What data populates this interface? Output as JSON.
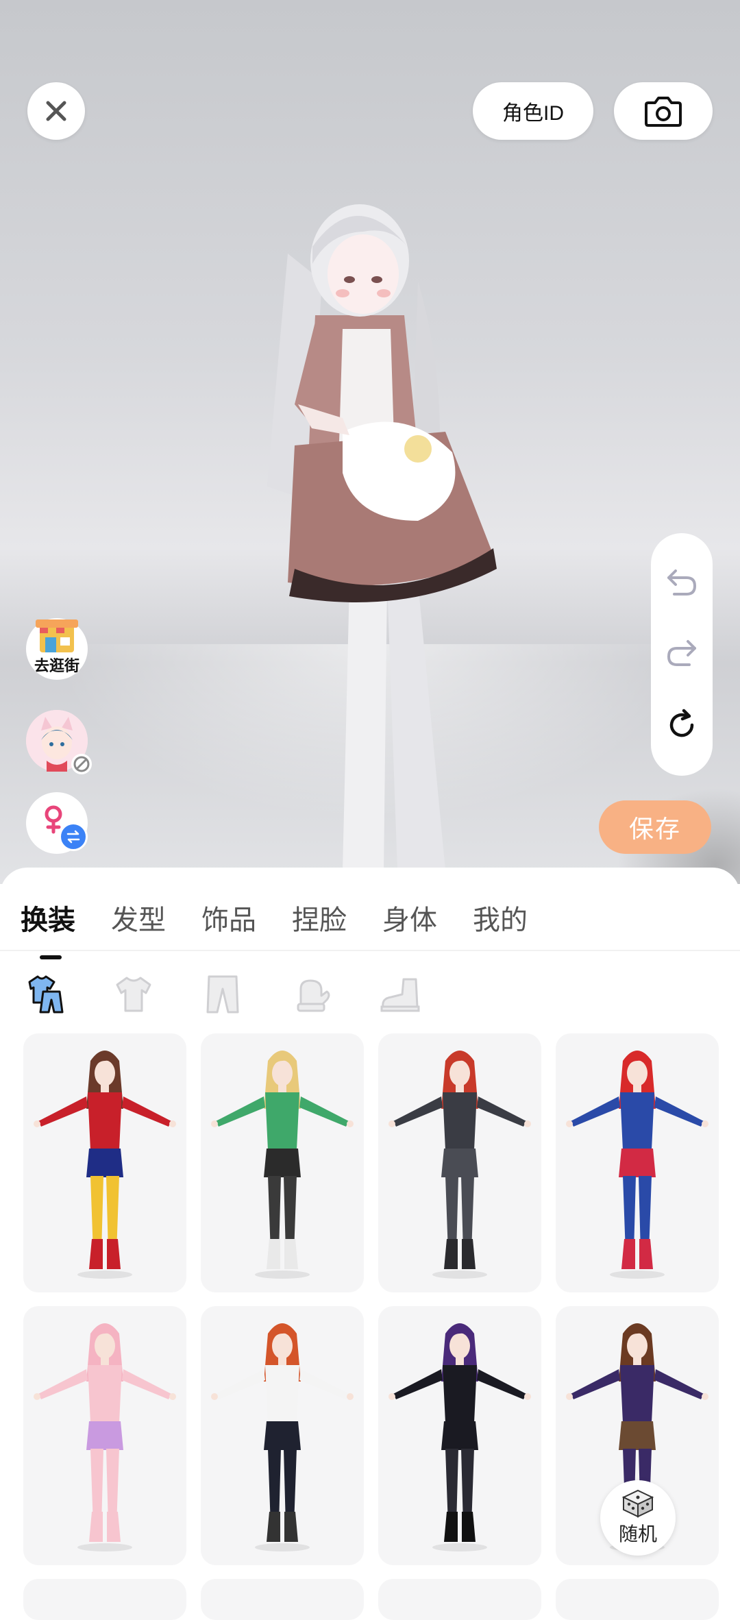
{
  "header": {
    "role_id_label": "角色ID"
  },
  "side": {
    "shop_label": "去逛街"
  },
  "actions": {
    "save_label": "保存",
    "random_label": "随机"
  },
  "icons": [
    "close-icon",
    "camera-icon",
    "undo-icon",
    "redo-icon",
    "reset-icon",
    "shop-icon",
    "no-entry-icon",
    "female-icon",
    "swap-icon",
    "outfit-icon",
    "top-icon",
    "bottom-icon",
    "gloves-icon",
    "shoes-icon",
    "dice-icon"
  ],
  "colors": {
    "accent_save": "#f8b184",
    "active_tab": "#111111",
    "inactive_tab": "#555555",
    "badge_blue": "#3b82f6",
    "card_bg": "#f5f5f6"
  },
  "tabs": [
    {
      "label": "换装",
      "active": true
    },
    {
      "label": "发型",
      "active": false
    },
    {
      "label": "饰品",
      "active": false
    },
    {
      "label": "捏脸",
      "active": false
    },
    {
      "label": "身体",
      "active": false
    },
    {
      "label": "我的",
      "active": false
    }
  ],
  "outfits": [
    {
      "hair": "#6b3a2a",
      "top": "#c8202a",
      "bottom": "#1f2d86",
      "legs": "#f1c232",
      "boots": "#c8202a"
    },
    {
      "hair": "#e8c97a",
      "top": "#3fa86a",
      "bottom": "#2b2b2b",
      "legs": "#3a3a3a",
      "boots": "#e9e9e9"
    },
    {
      "hair": "#c83a2a",
      "top": "#3a3c44",
      "bottom": "#4a4c54",
      "legs": "#4a4c54",
      "boots": "#2a2a2e"
    },
    {
      "hair": "#d82a2a",
      "top": "#2a4aa8",
      "bottom": "#d22a44",
      "legs": "#2a4aa8",
      "boots": "#d22a44"
    },
    {
      "hair": "#f5b3c2",
      "top": "#f7c5cf",
      "bottom": "#c99ae0",
      "legs": "#f7c5cf",
      "boots": "#f7c5cf"
    },
    {
      "hair": "#d4552a",
      "top": "#f4f4f4",
      "bottom": "#1f2230",
      "legs": "#1f2230",
      "boots": "#333333"
    },
    {
      "hair": "#4a2a7a",
      "top": "#1a1a22",
      "bottom": "#1a1a22",
      "legs": "#2a2a33",
      "boots": "#111111"
    },
    {
      "hair": "#6b3a22",
      "top": "#3a2a66",
      "bottom": "#6b4a32",
      "legs": "#3a2a66",
      "boots": "#2a2a2a"
    }
  ]
}
